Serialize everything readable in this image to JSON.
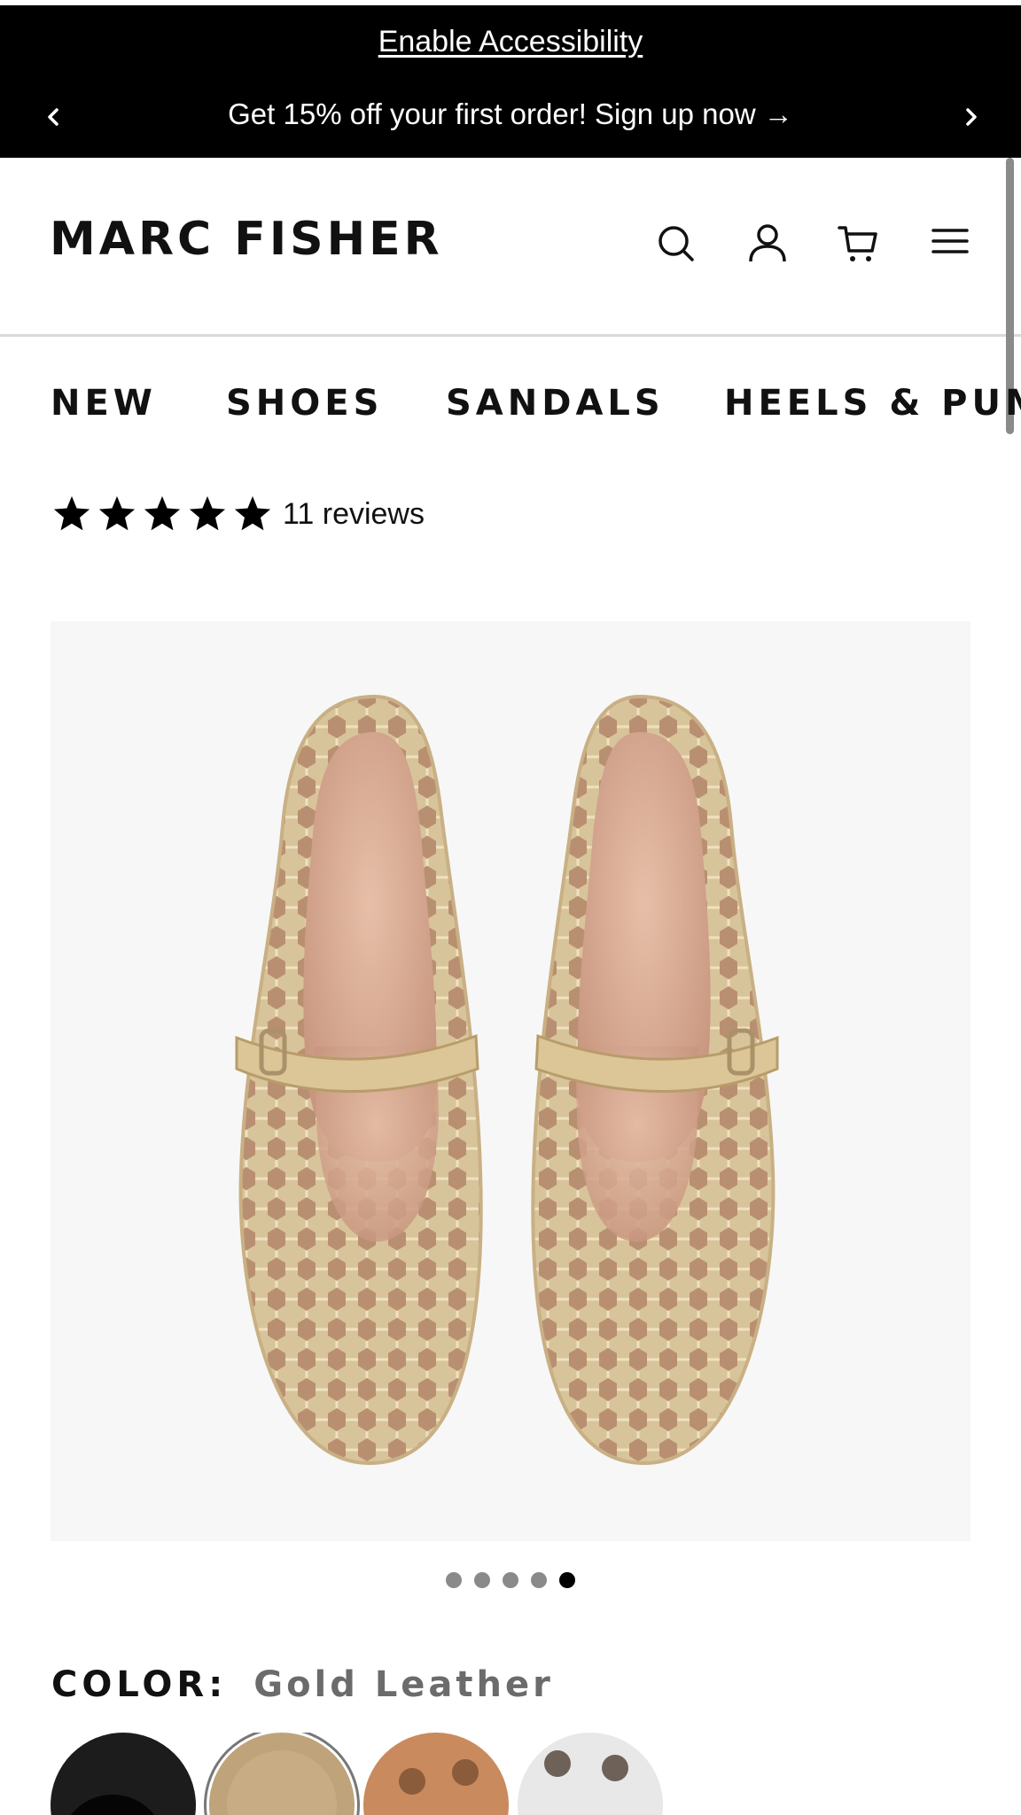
{
  "announcement": {
    "accessibility_link": "Enable Accessibility",
    "promo_text": "Get 15% off your first order! Sign up now →",
    "prev_icon": "chevron-left-icon",
    "next_icon": "chevron-right-icon",
    "background": "#000000",
    "text_color": "#ffffff"
  },
  "header": {
    "logo_text": "MARC FISHER",
    "icons": [
      "search-icon",
      "account-icon",
      "cart-icon",
      "menu-icon"
    ]
  },
  "nav": {
    "categories": [
      "NEW",
      "SHOES",
      "SANDALS",
      "HEELS & PUMPS"
    ]
  },
  "rating": {
    "stars": 5,
    "reviews_label": "11 reviews"
  },
  "gallery": {
    "image_alt": "Gold woven leather mary jane flats, top view",
    "image_count": 5,
    "active_index": 5
  },
  "color": {
    "label": "COLOR:",
    "value": "Gold Leather",
    "swatches": [
      {
        "name": "Black",
        "color": "#1c1c1c"
      },
      {
        "name": "Gold Leather",
        "color": "#bfa37a",
        "selected": true
      },
      {
        "name": "Cognac Woven",
        "color": "#c98a5e"
      },
      {
        "name": "White Woven",
        "color": "#e8e8e8"
      }
    ]
  }
}
